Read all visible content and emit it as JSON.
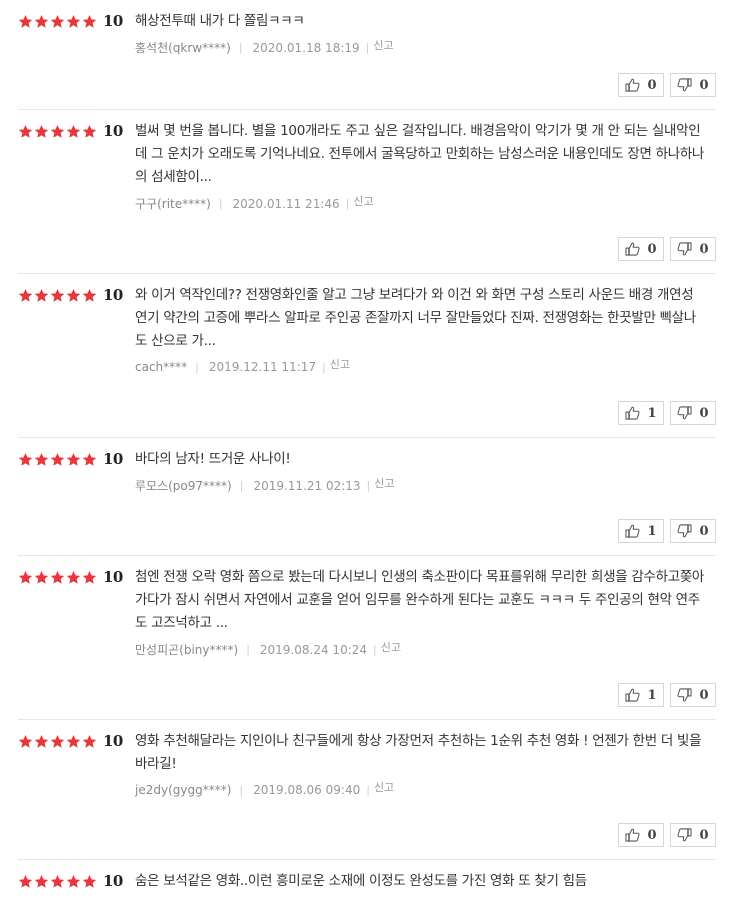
{
  "report_label": "신고",
  "colors": {
    "star": "#e8363d",
    "border": "#e6e6e6"
  },
  "icons": {
    "like": "thumbs-up-icon",
    "dislike": "thumbs-down-icon",
    "star": "star-icon"
  },
  "reviews": [
    {
      "stars": 5,
      "score": "10",
      "text": "해상전투때 내가 다 쫄림ㅋㅋㅋ",
      "author": "홍석천(qkrw****)",
      "date": "2020.01.18 18:19",
      "likes": "0",
      "dislikes": "0"
    },
    {
      "stars": 5,
      "score": "10",
      "text": "벌써 몇 번을 봅니다. 별을 100개라도 주고 싶은 걸작입니다. 배경음악이 악기가 몇 개 안 되는 실내악인데 그 운치가 오래도록 기억나네요. 전투에서 굴욕당하고 만회하는 남성스러운 내용인데도 장면 하나하나의 섬세함이...",
      "author": "구구(rite****)",
      "date": "2020.01.11 21:46",
      "likes": "0",
      "dislikes": "0"
    },
    {
      "stars": 5,
      "score": "10",
      "text": "와 이거 역작인데?? 전쟁영화인줄 알고 그냥 보려다가 와 이건 와 화면 구성 스토리 사운드 배경 개연성 연기 약간의 고증에 뿌라스 알파로 주인공 존잘까지 너무 잘만들었다 진짜. 전쟁영화는 한끗발만 삑살나도 산으로 가...",
      "author": "cach****",
      "date": "2019.12.11 11:17",
      "likes": "1",
      "dislikes": "0"
    },
    {
      "stars": 5,
      "score": "10",
      "text": "바다의 남자! 뜨거운 사나이!",
      "author": "루모스(po97****)",
      "date": "2019.11.21 02:13",
      "likes": "1",
      "dislikes": "0"
    },
    {
      "stars": 5,
      "score": "10",
      "text": "첨엔 전쟁 오락 영화 쯤으로 봤는데 다시보니 인생의 축소판이다 목표를위해 무리한 희생을 감수하고쫒아가다가 잠시 쉬면서 자연에서 교훈을 얻어 임무를 완수하게 된다는 교훈도 ㅋㅋㅋ 두 주인공의 현악 연주도 고즈넉하고 ...",
      "author": "만성피곤(biny****)",
      "date": "2019.08.24 10:24",
      "likes": "1",
      "dislikes": "0"
    },
    {
      "stars": 5,
      "score": "10",
      "text": "영화 추천해달라는 지인이나 친구들에게 항상 가장먼저 추천하는 1순위 추천 영화 ! 언젠가 한번 더 빛을 바라길!",
      "author": "je2dy(gygg****)",
      "date": "2019.08.06 09:40",
      "likes": "0",
      "dislikes": "0"
    },
    {
      "stars": 5,
      "score": "10",
      "text": "숨은 보석같은 영화..이런 흥미로운 소재에 이정도 완성도를 가진 영화 또 찾기 힘듬"
    }
  ]
}
